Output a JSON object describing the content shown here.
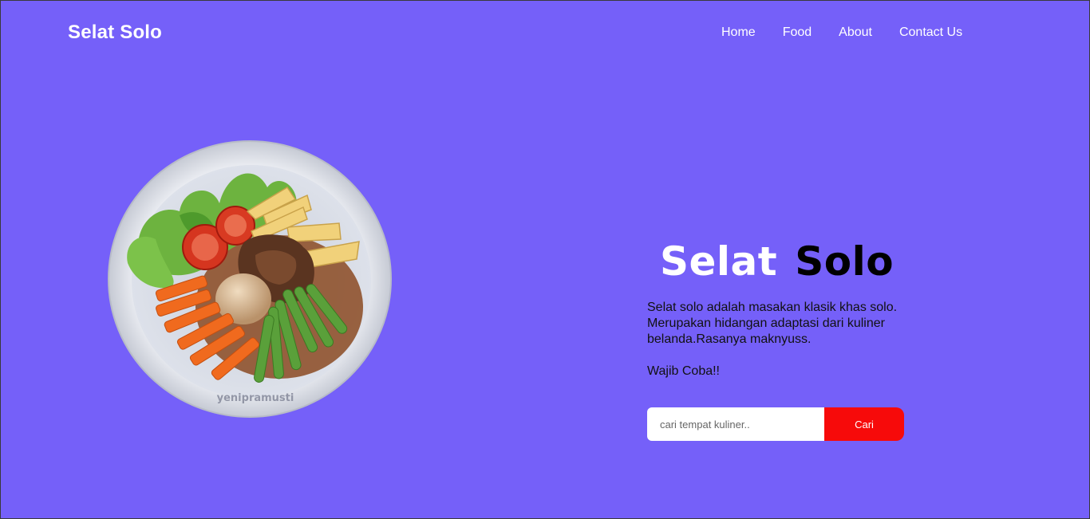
{
  "navbar": {
    "brand": "Selat Solo",
    "links": [
      {
        "label": "Home"
      },
      {
        "label": "Food"
      },
      {
        "label": "About"
      },
      {
        "label": "Contact Us"
      }
    ]
  },
  "hero": {
    "image": {
      "watermark": "yenipramusti"
    },
    "title_part1": "Selat",
    "title_part2": "Solo",
    "description": "Selat solo adalah masakan klasik khas solo. Merupakan hidangan adaptasi dari kuliner belanda.Rasanya maknyuss.",
    "cta": "Wajib Coba!!"
  },
  "search": {
    "placeholder": "cari tempat kuliner..",
    "button_label": "Cari"
  },
  "colors": {
    "background": "#7560f9",
    "button": "#f70a0a",
    "text_light": "#ffffff",
    "text_dark": "#000000"
  }
}
